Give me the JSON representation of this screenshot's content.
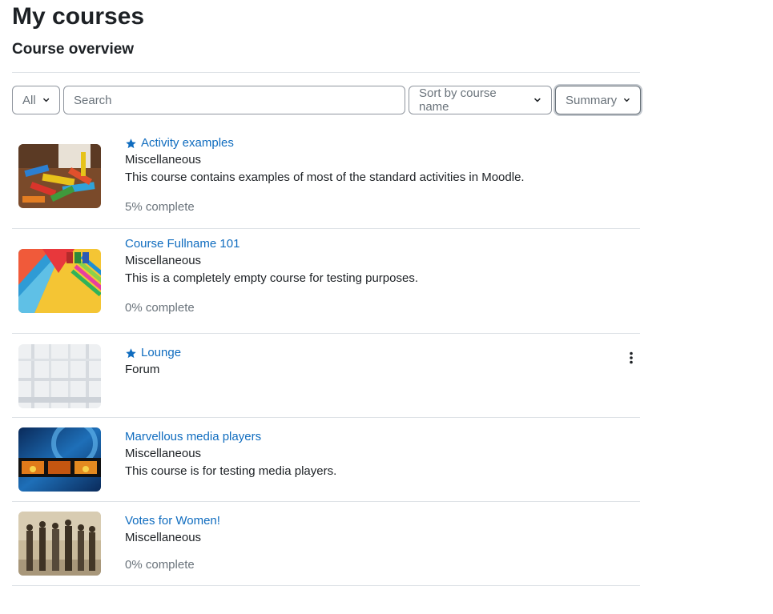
{
  "page": {
    "title": "My courses",
    "block_title": "Course overview"
  },
  "controls": {
    "filter_label": "All",
    "search_placeholder": "Search",
    "search_value": "",
    "sort_label": "Sort by course name",
    "view_label": "Summary"
  },
  "courses": [
    {
      "name": "Activity examples",
      "starred": true,
      "category": "Miscellaneous",
      "summary": "This course contains examples of most of the standard activities in Moodle.",
      "progress": "5% complete",
      "progress_value": 5
    },
    {
      "name": "Course Fullname 101",
      "starred": false,
      "category": "Miscellaneous",
      "summary": "This is a completely empty course for testing purposes.",
      "progress": "0% complete",
      "progress_value": 0
    },
    {
      "name": "Lounge",
      "starred": true,
      "category": "Forum",
      "summary": "",
      "progress": ""
    },
    {
      "name": "Marvellous media players",
      "starred": false,
      "category": "Miscellaneous",
      "summary": "This course is for testing media players.",
      "progress": ""
    },
    {
      "name": "Votes for Women!",
      "starred": false,
      "category": "Miscellaneous",
      "summary": "",
      "progress": "0% complete",
      "progress_value": 0
    }
  ],
  "colors": {
    "link": "#0f6cbf",
    "text": "#1d2125",
    "muted": "#6a737b",
    "divider": "#dee2e6"
  },
  "icons": {
    "star": "star-icon",
    "caret": "chevron-down-icon",
    "kebab": "kebab-menu-icon"
  }
}
